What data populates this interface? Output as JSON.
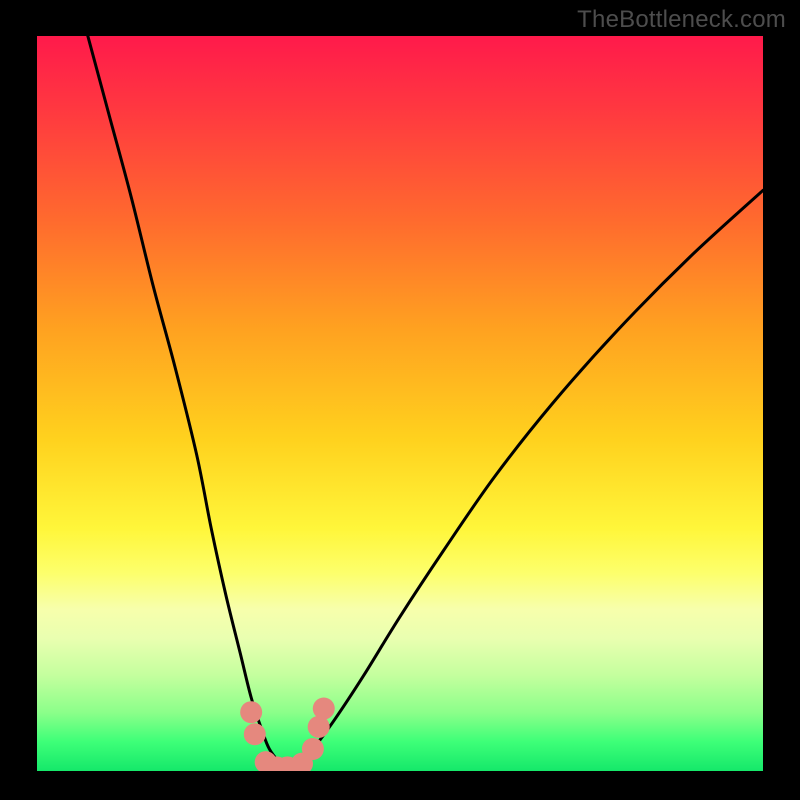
{
  "watermark": "TheBottleneck.com",
  "chart_data": {
    "type": "line",
    "title": "",
    "xlabel": "",
    "ylabel": "",
    "xlim": [
      0,
      100
    ],
    "ylim": [
      0,
      100
    ],
    "series": [
      {
        "name": "curve-left",
        "x": [
          7,
          10,
          13,
          16,
          19,
          22,
          24,
          26,
          28,
          29.5,
          31,
          32,
          33.5,
          34.5
        ],
        "values": [
          100,
          89,
          78,
          66,
          55,
          43,
          33,
          24,
          16,
          10,
          5.5,
          3,
          1,
          0
        ]
      },
      {
        "name": "curve-right",
        "x": [
          34.5,
          36,
          38,
          41,
          45,
          50,
          56,
          63,
          71,
          80,
          90,
          100
        ],
        "values": [
          0,
          1,
          3,
          7,
          13,
          21,
          30,
          40,
          50,
          60,
          70,
          79
        ]
      },
      {
        "name": "dots",
        "type": "scatter",
        "x": [
          29.5,
          30.0,
          31.5,
          33.0,
          34.5,
          36.5,
          38.0,
          38.8,
          39.5
        ],
        "values": [
          8.0,
          5.0,
          1.2,
          0.5,
          0.5,
          1.0,
          3.0,
          6.0,
          8.5
        ]
      }
    ],
    "background_gradient": {
      "top": "#ff1a4b",
      "mid": "#fff63a",
      "bottom": "#15e86a"
    },
    "dot_color": "#e5887e",
    "curve_color": "#000000"
  }
}
